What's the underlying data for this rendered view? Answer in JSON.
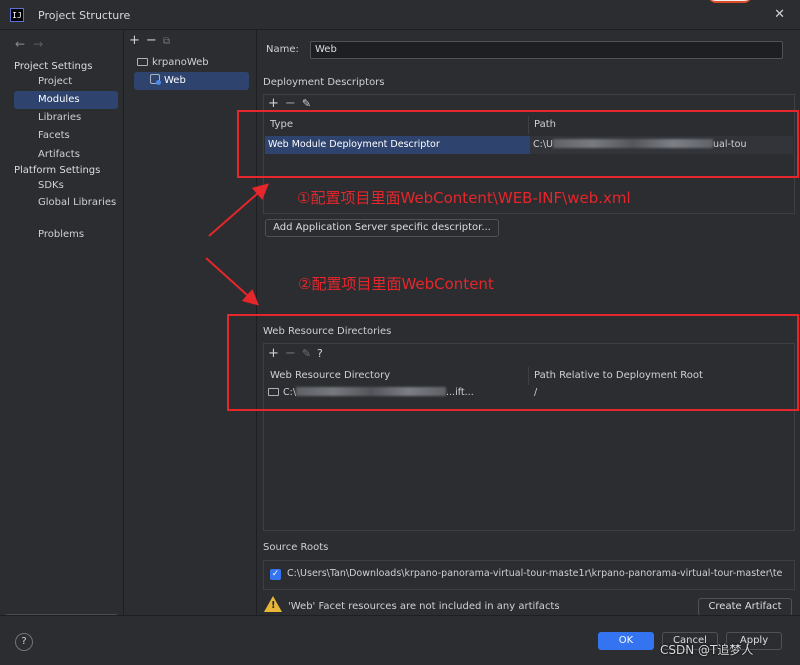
{
  "window": {
    "title": "Project Structure",
    "app_icon_text": "IJ",
    "close_glyph": "✕"
  },
  "nav": {
    "back": "←",
    "forward": "→",
    "project_settings_heading": "Project Settings",
    "project_settings_items": [
      "Project",
      "Modules",
      "Libraries",
      "Facets",
      "Artifacts"
    ],
    "selected": "Modules",
    "platform_settings_heading": "Platform Settings",
    "platform_settings_items": [
      "SDKs",
      "Global Libraries"
    ],
    "other_items": [
      "Problems"
    ]
  },
  "tree": {
    "toolbar": {
      "add": "+",
      "remove": "−",
      "copy": "⧉"
    },
    "root": "krpanoWeb",
    "child": "Web"
  },
  "main": {
    "name_label": "Name:",
    "name_value": "Web",
    "deployment_descriptors_title": "Deployment Descriptors",
    "dd_toolbar": {
      "add": "+",
      "remove": "−",
      "edit": "✎"
    },
    "dd_columns": [
      "Type",
      "Path"
    ],
    "dd_row": {
      "type": "Web Module Deployment Descriptor",
      "path_prefix": "C:\\U",
      "path_suffix": "ual-tou"
    },
    "add_descriptor_button": "Add Application Server specific descriptor...",
    "web_resource_title": "Web Resource Directories",
    "wr_toolbar": {
      "add": "+",
      "remove": "−",
      "edit": "✎",
      "help": "?"
    },
    "wr_columns": [
      "Web Resource Directory",
      "Path Relative to Deployment Root"
    ],
    "wr_row": {
      "dir_prefix": "C:\\",
      "dir_suffix": "...ift...",
      "relative": "/"
    },
    "source_roots_title": "Source Roots",
    "source_root_path": "C:\\Users\\Tan\\Downloads\\krpano-panorama-virtual-tour-maste1r\\krpano-panorama-virtual-tour-master\\te",
    "warning_text": "'Web' Facet resources are not included in any artifacts",
    "create_artifact_button": "Create Artifact"
  },
  "annotations": {
    "note1": "①配置项目里面WebContent\\WEB-INF\\web.xml",
    "note2": "②配置项目里面WebContent"
  },
  "footer": {
    "help": "?",
    "ok": "OK",
    "cancel": "Cancel",
    "apply": "Apply"
  },
  "watermark": "CSDN @T追梦人",
  "colors": {
    "background": "#2b2d30",
    "selection": "#2e436e",
    "primary_button": "#3574f0",
    "annotation_red": "#e5262b",
    "warning_yellow": "#e8b73a"
  }
}
